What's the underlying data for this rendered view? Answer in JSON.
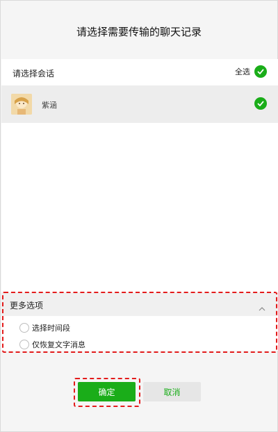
{
  "dialog": {
    "title": "请选择需要传输的聊天记录"
  },
  "conversations": {
    "header_label": "请选择会话",
    "select_all_label": "全选",
    "items": [
      {
        "name": "紫涵",
        "selected": true
      }
    ]
  },
  "more_options": {
    "title": "更多选项",
    "options": [
      {
        "label": "选择时间段",
        "checked": false
      },
      {
        "label": "仅恢复文字消息",
        "checked": false
      }
    ]
  },
  "actions": {
    "confirm_label": "确定",
    "cancel_label": "取消"
  },
  "colors": {
    "accent": "#1aad19",
    "highlight_annotation": "#e31b1b"
  }
}
